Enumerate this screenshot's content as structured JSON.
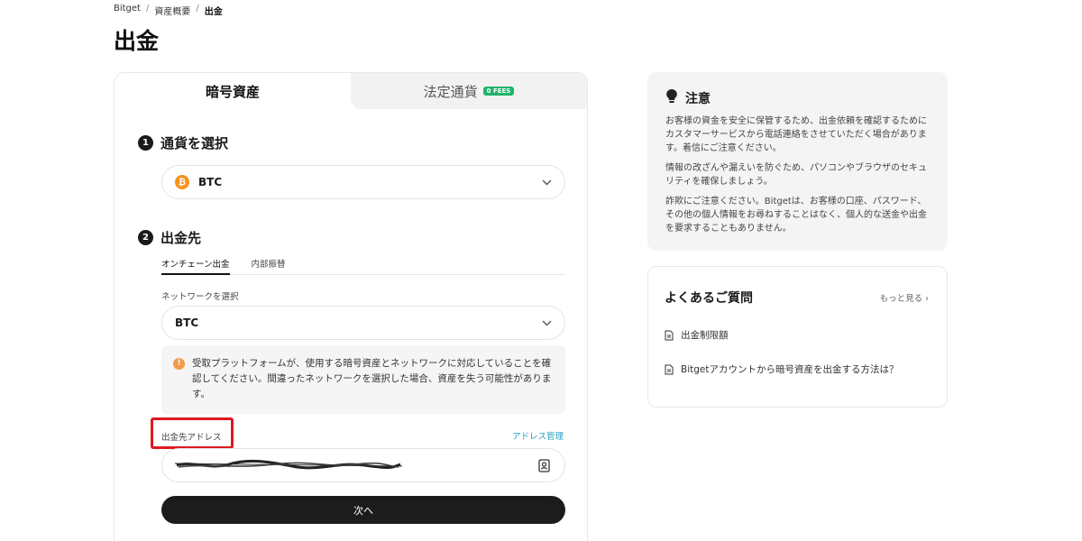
{
  "breadcrumb": {
    "items": [
      "Bitget",
      "資産概要",
      "出金"
    ],
    "separator": "/"
  },
  "page_title": "出金",
  "tabs": {
    "crypto": "暗号資産",
    "fiat": "法定通貨",
    "fees_badge": "0 FEES"
  },
  "step1": {
    "number": "1",
    "title": "通貨を選択",
    "coin": "BTC",
    "coin_symbol": "₿"
  },
  "step2": {
    "number": "2",
    "title": "出金先",
    "subtabs": [
      "オンチェーン出金",
      "内部振替"
    ],
    "network_label": "ネットワークを選択",
    "network_value": "BTC",
    "warning_text": "受取プラットフォームが、使用する暗号資産とネットワークに対応していることを確認してください。間違ったネットワークを選択した場合、資産を失う可能性があります。",
    "address_label": "出金先アドレス",
    "address_manage": "アドレス管理",
    "next_button": "次へ"
  },
  "notice": {
    "title": "注意",
    "paragraphs": [
      "お客様の資金を安全に保管するため、出金依頼を確認するためにカスタマーサービスから電話連絡をさせていただく場合があります。着信にご注意ください。",
      "情報の改ざんや漏えいを防ぐため、パソコンやブラウザのセキュリティを確保しましょう。",
      "詐欺にご注意ください。Bitgetは、お客様の口座、パスワード、その他の個人情報をお尋ねすることはなく、個人的な送金や出金を要求することもありません。"
    ]
  },
  "faq": {
    "title": "よくあるご質問",
    "more": "もっと見る",
    "items": [
      "出金制限額",
      "Bitgetアカウントから暗号資産を出金する方法は？"
    ]
  },
  "colors": {
    "accent_link": "#2a9fc2",
    "fees_green": "#1fb46b",
    "highlight_red": "#e0191f",
    "btc_orange": "#f7931a",
    "warn_orange": "#f29b4b"
  }
}
